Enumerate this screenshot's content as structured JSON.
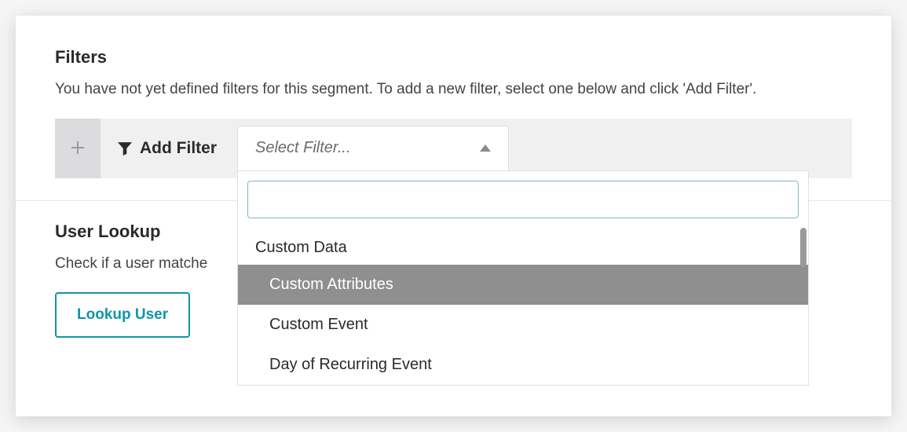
{
  "filters": {
    "title": "Filters",
    "description": "You have not yet defined filters for this segment. To add a new filter, select one below and click 'Add Filter'.",
    "add_filter_label": "Add Filter",
    "select_placeholder": "Select Filter...",
    "dropdown": {
      "group_header": "Custom Data",
      "items": [
        {
          "label": "Custom Attributes",
          "highlighted": true
        },
        {
          "label": "Custom Event",
          "highlighted": false
        },
        {
          "label": "Day of Recurring Event",
          "highlighted": false
        }
      ]
    }
  },
  "lookup": {
    "title": "User Lookup",
    "description": "Check if a user matche",
    "button_label": "Lookup User"
  }
}
